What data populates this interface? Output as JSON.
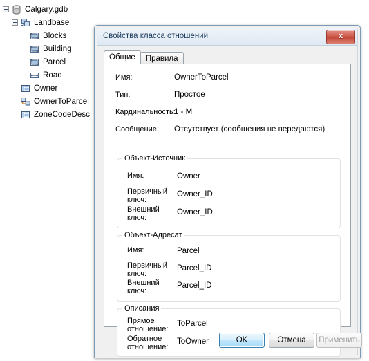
{
  "tree": {
    "nodes": [
      {
        "label": "Calgary.gdb",
        "icon": "geodatabase-icon",
        "depth": 0,
        "expander": "expanded"
      },
      {
        "label": "Landbase",
        "icon": "feature-dataset-icon",
        "depth": 1,
        "expander": "expanded"
      },
      {
        "label": "Blocks",
        "icon": "polygon-feature-class-icon",
        "depth": 2,
        "expander": "none"
      },
      {
        "label": "Building",
        "icon": "polygon-feature-class-icon",
        "depth": 2,
        "expander": "none"
      },
      {
        "label": "Parcel",
        "icon": "polygon-feature-class-icon",
        "depth": 2,
        "expander": "none"
      },
      {
        "label": "Road",
        "icon": "line-feature-class-icon",
        "depth": 2,
        "expander": "none"
      },
      {
        "label": "Owner",
        "icon": "table-icon",
        "depth": 1,
        "expander": "none"
      },
      {
        "label": "OwnerToParcel",
        "icon": "relationship-class-icon",
        "depth": 1,
        "expander": "none"
      },
      {
        "label": "ZoneCodeDesc",
        "icon": "table-icon",
        "depth": 1,
        "expander": "none"
      }
    ]
  },
  "dialog": {
    "title": "Свойства класса отношений",
    "close_label": "x",
    "tabs": [
      {
        "label": "Общие",
        "active": true
      },
      {
        "label": "Правила",
        "active": false
      }
    ],
    "general": {
      "fields": [
        {
          "label": "Имя:",
          "value": "OwnerToParcel"
        },
        {
          "label": "Тип:",
          "value": "Простое"
        },
        {
          "label": "Кардинальность:",
          "value": "1 - M"
        },
        {
          "label": "Сообщение:",
          "value": "Отсутствует (сообщения не передаются)"
        }
      ],
      "origin_group": {
        "title": "Объект-Источник",
        "rows": [
          {
            "label": "Имя:",
            "value": "Owner"
          },
          {
            "label": "Первичный\nключ:",
            "value": "Owner_ID"
          },
          {
            "label": "Внешний\nключ:",
            "value": "Owner_ID"
          }
        ]
      },
      "destination_group": {
        "title": "Объект-Адресат",
        "rows": [
          {
            "label": "Имя:",
            "value": "Parcel"
          },
          {
            "label": "Первичный\nключ:",
            "value": "Parcel_ID"
          },
          {
            "label": "Внешний\nключ:",
            "value": "Parcel_ID"
          }
        ]
      },
      "labels_group": {
        "title": "Описания",
        "rows": [
          {
            "label": "Прямое\nотношение:",
            "value": "ToParcel"
          },
          {
            "label": "Обратное\nотношение:",
            "value": "ToOwner"
          }
        ]
      }
    },
    "buttons": {
      "ok": "OK",
      "cancel": "Отмена",
      "apply": "Применить"
    }
  },
  "colors": {
    "dialog_border": "#7c9bb8",
    "title_bar": "#e7eff7",
    "close_button": "#c34a3b",
    "default_button": "#3c7fb1",
    "panel": "#ffffff",
    "dialog_face": "#f0f0f0"
  }
}
